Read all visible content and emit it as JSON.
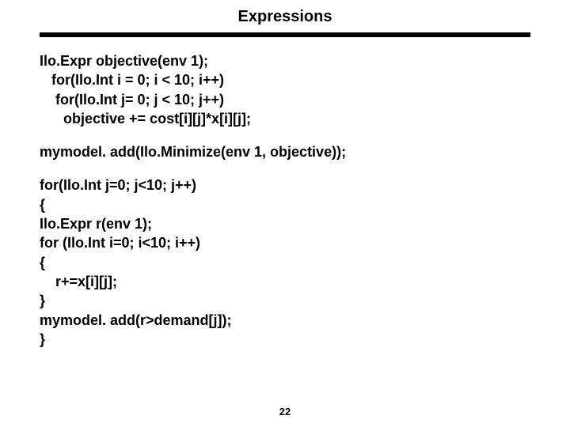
{
  "title": "Expressions",
  "code": {
    "block1": {
      "l1": "Ilo.Expr objective(env 1);",
      "l2": "   for(Ilo.Int i = 0; i < 10; i++)",
      "l3": "    for(Ilo.Int j= 0; j < 10; j++)",
      "l4": "      objective += cost[i][j]*x[i][j];"
    },
    "block2": {
      "l1": "mymodel. add(Ilo.Minimize(env 1, objective));"
    },
    "block3": {
      "l1": "for(Ilo.Int j=0; j<10; j++)",
      "l2": "{",
      "l3": "Ilo.Expr r(env 1);",
      "l4": "for (Ilo.Int i=0; i<10; i++)",
      "l5": "{",
      "l6": "    r+=x[i][j];",
      "l7": "}",
      "l8": "mymodel. add(r>demand[j]);",
      "l9": "}"
    }
  },
  "page_number": "22"
}
